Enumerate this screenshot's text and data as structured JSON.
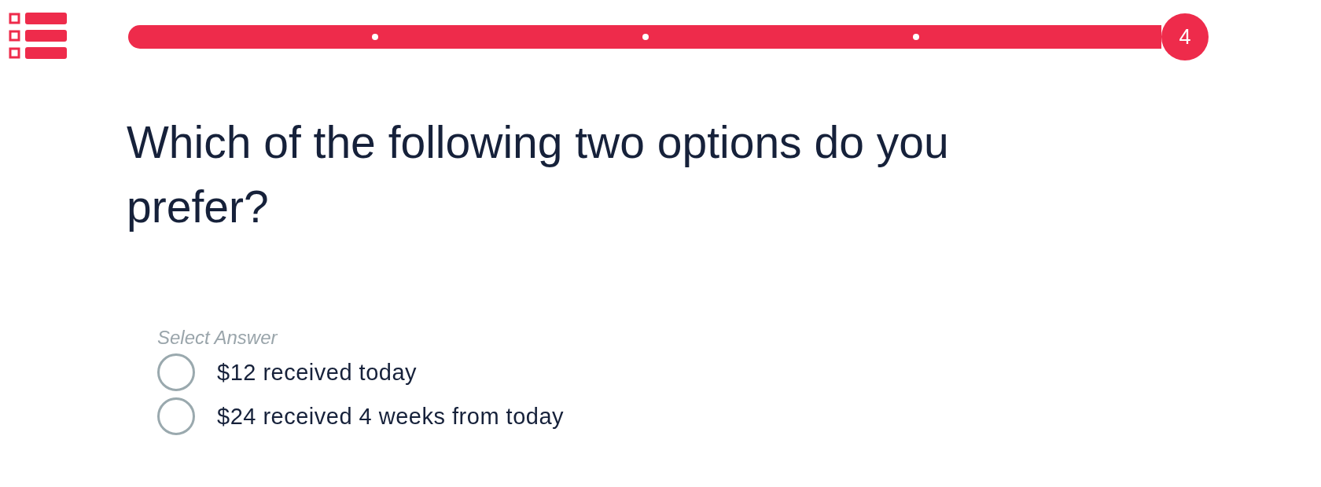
{
  "progress": {
    "steps": [
      {
        "selected": false
      },
      {
        "selected": false
      },
      {
        "selected": false
      },
      {
        "selected": true,
        "label": "4"
      }
    ]
  },
  "question": {
    "title": "Which of the following two options do you prefer?",
    "hint": "Select Answer",
    "options": [
      {
        "label": "$12 received today",
        "selected": false
      },
      {
        "label": "$24 received 4 weeks from today",
        "selected": false
      }
    ]
  }
}
